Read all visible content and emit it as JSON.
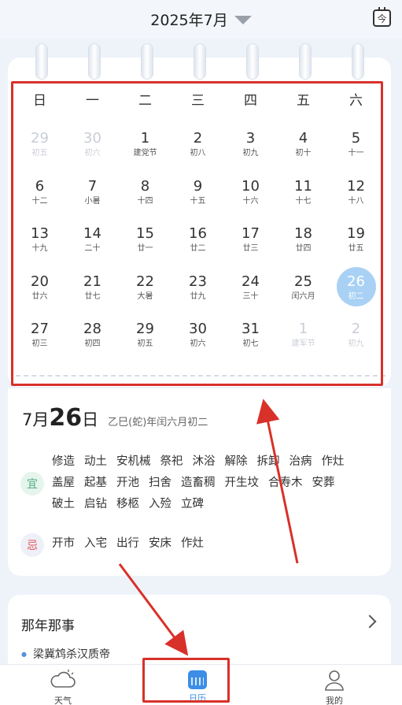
{
  "header": {
    "month_title": "2025年7月",
    "today_label": "今"
  },
  "weekdays": [
    "日",
    "一",
    "二",
    "三",
    "四",
    "五",
    "六"
  ],
  "calendar": {
    "weeks": [
      [
        {
          "num": "29",
          "sub": "初五",
          "other": true
        },
        {
          "num": "30",
          "sub": "初六",
          "other": true
        },
        {
          "num": "1",
          "sub": "建党节"
        },
        {
          "num": "2",
          "sub": "初八"
        },
        {
          "num": "3",
          "sub": "初九"
        },
        {
          "num": "4",
          "sub": "初十"
        },
        {
          "num": "5",
          "sub": "十一"
        }
      ],
      [
        {
          "num": "6",
          "sub": "十二"
        },
        {
          "num": "7",
          "sub": "小暑"
        },
        {
          "num": "8",
          "sub": "十四"
        },
        {
          "num": "9",
          "sub": "十五"
        },
        {
          "num": "10",
          "sub": "十六"
        },
        {
          "num": "11",
          "sub": "十七"
        },
        {
          "num": "12",
          "sub": "十八"
        }
      ],
      [
        {
          "num": "13",
          "sub": "十九"
        },
        {
          "num": "14",
          "sub": "二十"
        },
        {
          "num": "15",
          "sub": "廿一"
        },
        {
          "num": "16",
          "sub": "廿二"
        },
        {
          "num": "17",
          "sub": "廿三"
        },
        {
          "num": "18",
          "sub": "廿四"
        },
        {
          "num": "19",
          "sub": "廿五"
        }
      ],
      [
        {
          "num": "20",
          "sub": "廿六"
        },
        {
          "num": "21",
          "sub": "廿七"
        },
        {
          "num": "22",
          "sub": "大暑"
        },
        {
          "num": "23",
          "sub": "廿九"
        },
        {
          "num": "24",
          "sub": "三十"
        },
        {
          "num": "25",
          "sub": "闰六月"
        },
        {
          "num": "26",
          "sub": "初二",
          "selected": true
        }
      ],
      [
        {
          "num": "27",
          "sub": "初三"
        },
        {
          "num": "28",
          "sub": "初四"
        },
        {
          "num": "29",
          "sub": "初五"
        },
        {
          "num": "30",
          "sub": "初六"
        },
        {
          "num": "31",
          "sub": "初七"
        },
        {
          "num": "1",
          "sub": "建军节",
          "other": true
        },
        {
          "num": "2",
          "sub": "初九",
          "other": true
        }
      ]
    ]
  },
  "info": {
    "month": "7月",
    "day": "26",
    "day_suffix": "日",
    "lunar": "乙巳(蛇)年闰六月初二",
    "yi_label": "宜",
    "ji_label": "忌",
    "yi": [
      "修造",
      "动土",
      "安机械",
      "祭祀",
      "沐浴",
      "解除",
      "拆卸",
      "治病",
      "作灶",
      "盖屋",
      "起基",
      "开池",
      "扫舍",
      "造畜稠",
      "开生坟",
      "合寿木",
      "安葬",
      "破土",
      "启钻",
      "移柩",
      "入殓",
      "立碑"
    ],
    "ji": [
      "开市",
      "入宅",
      "出行",
      "安床",
      "作灶"
    ]
  },
  "history": {
    "title": "那年那事",
    "item": "梁冀鸩杀汉质帝"
  },
  "nav": {
    "weather": "天气",
    "calendar": "日历",
    "mine": "我的"
  },
  "colors": {
    "accent": "#3d8ee6",
    "selected": "#a9d1f5",
    "annotation": "#d8312a"
  }
}
